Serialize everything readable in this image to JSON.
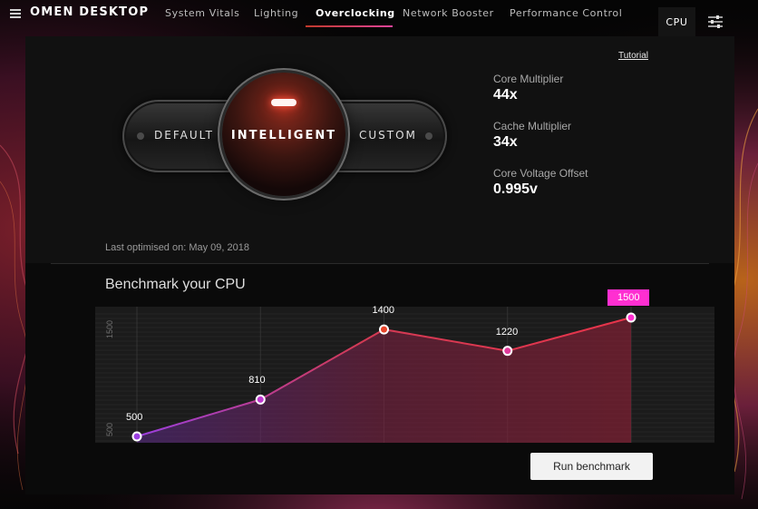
{
  "app": {
    "title": "OMEN DESKTOP"
  },
  "nav": {
    "tabs": [
      {
        "label": "System Vitals"
      },
      {
        "label": "Lighting"
      },
      {
        "label": "Overclocking",
        "active": true
      },
      {
        "label": "Network Booster"
      },
      {
        "label": "Performance Control"
      }
    ]
  },
  "header_right": {
    "cpu_label": "CPU",
    "settings_icon": "sliders-icon"
  },
  "tutorial_link": "Tutorial",
  "mode_selector": {
    "options": [
      "DEFAULT",
      "INTELLIGENT",
      "CUSTOM"
    ],
    "selected": "INTELLIGENT"
  },
  "specs": [
    {
      "label": "Core Multiplier",
      "value": "44x"
    },
    {
      "label": "Cache Multiplier",
      "value": "34x"
    },
    {
      "label": "Core Voltage Offset",
      "value": "0.995v"
    }
  ],
  "last_optimised": "Last optimised on: May 09, 2018",
  "benchmark": {
    "title": "Benchmark your CPU",
    "run_label": "Run benchmark"
  },
  "chart_data": {
    "type": "line",
    "x": [
      1,
      2,
      3,
      4,
      5
    ],
    "values": [
      500,
      810,
      1400,
      1220,
      1500
    ],
    "data_labels": [
      "500",
      "810",
      "1400",
      "1220",
      "1500"
    ],
    "y_ticks": [
      "500",
      "1500"
    ],
    "ylim": [
      500,
      1500
    ],
    "highlight_last": true,
    "grid": true,
    "colors": {
      "start": "#9b3fe0",
      "end": "#e8344a",
      "highlight": "#ff2fd1"
    }
  },
  "colors": {
    "accent": "#e0449a",
    "accent_red": "#c0392b"
  }
}
